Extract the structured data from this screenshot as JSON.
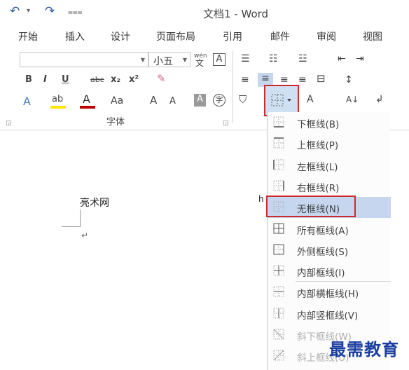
{
  "titlebar": {
    "undo_icon": "↶",
    "undo_arrow": "▾",
    "redo_icon": "↷",
    "customize_icon": "⩶",
    "doc_title": "文档1 - Word"
  },
  "tabs": [
    {
      "label": "开始"
    },
    {
      "label": "插入"
    },
    {
      "label": "设计"
    },
    {
      "label": "页面布局"
    },
    {
      "label": "引用"
    },
    {
      "label": "邮件"
    },
    {
      "label": "审阅"
    },
    {
      "label": "视图"
    }
  ],
  "ribbon": {
    "font_name": "",
    "font_size": "小五",
    "wen_label": "wén",
    "wen_char": "文",
    "char_border": "A",
    "bold": "B",
    "italic": "I",
    "underline": "U",
    "strike": "abc",
    "subscript": "x₂",
    "superscript": "x²",
    "text_effect": "A",
    "highlight": "ab",
    "font_color": "A",
    "change_case": "Aa",
    "grow": "A",
    "shrink": "A",
    "shade": "A",
    "enclose": "字",
    "sort": "A↓",
    "group_label": "字体",
    "accent_red": "#c00000",
    "highlight_yellow": "#ffe600"
  },
  "doc": {
    "text": "亮术网",
    "fragment": "h",
    "para_mark": "↵"
  },
  "border_menu": {
    "items": [
      {
        "label": "下框线(B)",
        "icon": "bottom-border-icon",
        "state": "normal"
      },
      {
        "label": "上框线(P)",
        "icon": "top-border-icon",
        "state": "normal"
      },
      {
        "label": "左框线(L)",
        "icon": "left-border-icon",
        "state": "normal"
      },
      {
        "label": "右框线(R)",
        "icon": "right-border-icon",
        "state": "normal"
      },
      {
        "label": "无框线(N)",
        "icon": "no-border-icon",
        "state": "selected"
      },
      {
        "label": "所有框线(A)",
        "icon": "all-borders-icon",
        "state": "normal"
      },
      {
        "label": "外侧框线(S)",
        "icon": "outside-borders-icon",
        "state": "normal"
      },
      {
        "label": "内部框线(I)",
        "icon": "inside-borders-icon",
        "state": "normal"
      },
      {
        "label": "内部横框线(H)",
        "icon": "inside-horizontal-border-icon",
        "state": "normal"
      },
      {
        "label": "内部竖框线(V)",
        "icon": "inside-vertical-border-icon",
        "state": "normal"
      },
      {
        "label": "斜下框线(W)",
        "icon": "diagonal-down-border-icon",
        "state": "disabled"
      },
      {
        "label": "斜上框线(U)",
        "icon": "diagonal-up-border-icon",
        "state": "disabled"
      }
    ],
    "highlight_color": "#c5d6ee",
    "callout_color": "#d02b2b"
  },
  "watermark": "最需教育"
}
